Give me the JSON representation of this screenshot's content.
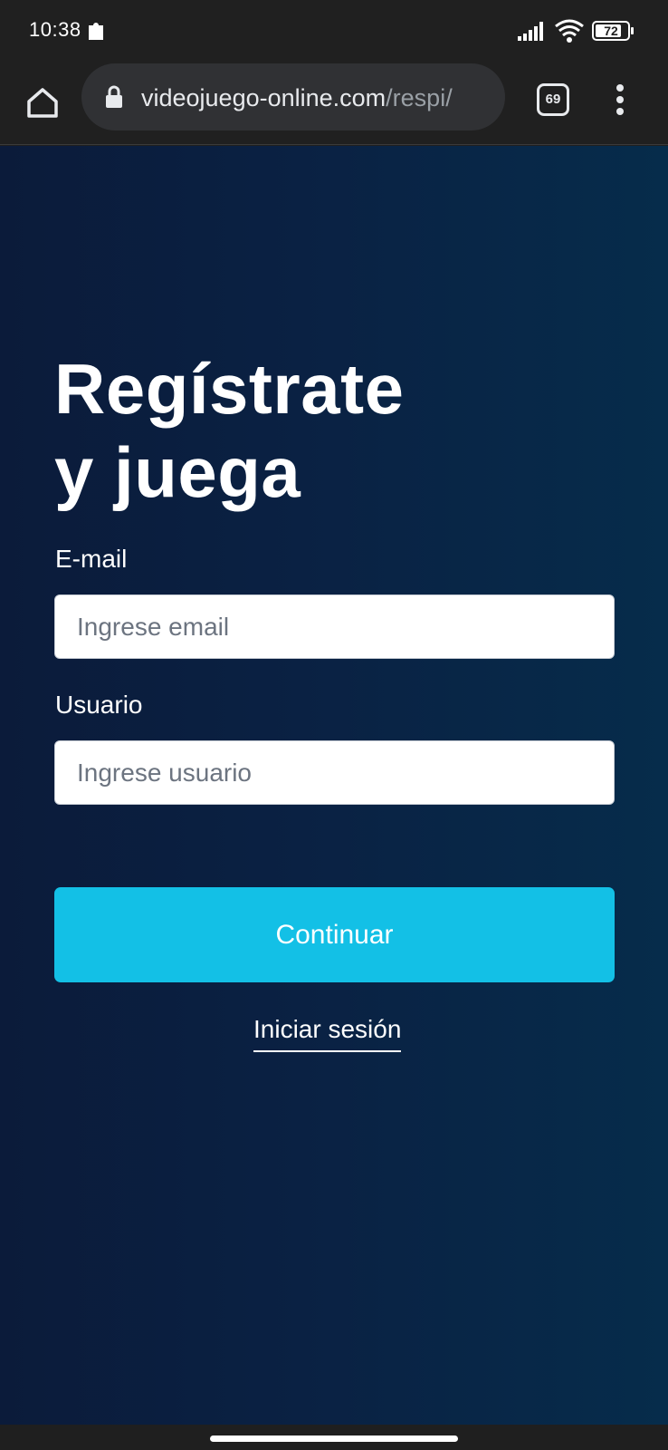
{
  "status_bar": {
    "time": "10:38",
    "battery": "72",
    "icons": [
      "puzzle-icon",
      "signal-icon",
      "wifi-icon",
      "battery-icon"
    ]
  },
  "browser": {
    "url_domain": "videojuego-online.com",
    "url_path": "/respi/",
    "tab_count": "69",
    "icons": [
      "home-icon",
      "lock-icon",
      "tabs-icon",
      "more-vert-icon"
    ]
  },
  "form": {
    "title_line1": "Regístrate",
    "title_line2": "y juega",
    "email_label": "E-mail",
    "email_placeholder": "Ingrese email",
    "email_value": "",
    "user_label": "Usuario",
    "user_placeholder": "Ingrese usuario",
    "user_value": "",
    "continue_label": "Continuar",
    "login_link": "Iniciar sesión"
  },
  "colors": {
    "accent": "#13c0e6",
    "background": "#0a2143"
  }
}
